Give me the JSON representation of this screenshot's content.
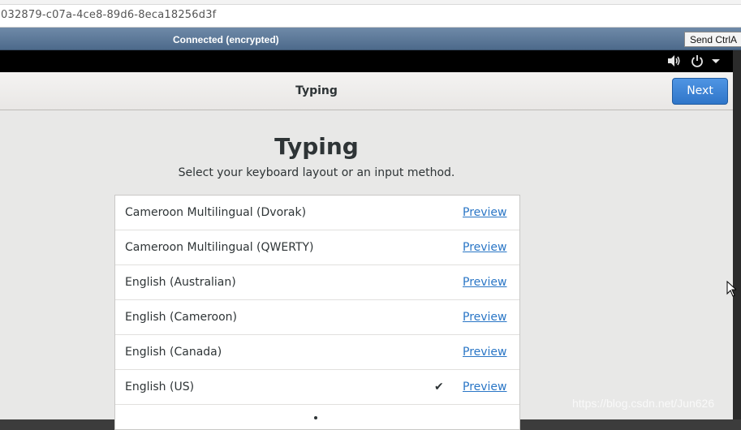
{
  "browser": {
    "url_fragment": "032879-c07a-4ce8-89d6-8eca18256d3f"
  },
  "vnc_bar": {
    "status": "Connected (encrypted)",
    "send_button": "Send CtrlA"
  },
  "top_bar": {
    "volume_icon": "volume-icon",
    "power_icon": "power-icon",
    "menu_icon": "chevron-down-icon"
  },
  "header": {
    "title": "Typing",
    "next_label": "Next",
    "accent_color": "#3584e4"
  },
  "page": {
    "title": "Typing",
    "subtitle": "Select your keyboard layout or an input method."
  },
  "layouts": [
    {
      "name": "Cameroon Multilingual (Dvorak)",
      "preview": "Preview",
      "selected": false
    },
    {
      "name": "Cameroon Multilingual (QWERTY)",
      "preview": "Preview",
      "selected": false
    },
    {
      "name": "English (Australian)",
      "preview": "Preview",
      "selected": false
    },
    {
      "name": "English (Cameroon)",
      "preview": "Preview",
      "selected": false
    },
    {
      "name": "English (Canada)",
      "preview": "Preview",
      "selected": false
    },
    {
      "name": "English (US)",
      "preview": "Preview",
      "selected": true,
      "check": "✔"
    }
  ],
  "watermark": "https://blog.csdn.net/Jun626"
}
